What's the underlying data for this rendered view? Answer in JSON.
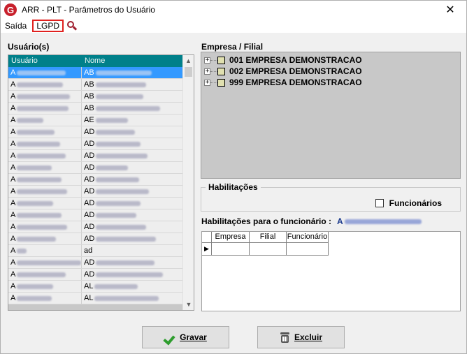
{
  "window": {
    "title": "ARR - PLT - Parâmetros do Usuário",
    "close_glyph": "✕",
    "app_icon_letter": "G",
    "app_icon_color": "#c8202c"
  },
  "menu": {
    "saida": "Saída",
    "lgpd": "LGPD",
    "search_icon": "search-icon"
  },
  "users": {
    "section_label": "Usuário(s)",
    "columns": [
      "Usuário",
      "Nome"
    ],
    "rows": [
      {
        "user": "A",
        "name": "AB"
      },
      {
        "user": "A",
        "name": "AB"
      },
      {
        "user": "A",
        "name": "AB"
      },
      {
        "user": "A",
        "name": "AB"
      },
      {
        "user": "A",
        "name": "AE"
      },
      {
        "user": "A",
        "name": "AD"
      },
      {
        "user": "A",
        "name": "AD"
      },
      {
        "user": "A",
        "name": "AD"
      },
      {
        "user": "A",
        "name": "AD"
      },
      {
        "user": "A",
        "name": "AD"
      },
      {
        "user": "A",
        "name": "AD"
      },
      {
        "user": "A",
        "name": "AD"
      },
      {
        "user": "A",
        "name": "AD"
      },
      {
        "user": "A",
        "name": "AD"
      },
      {
        "user": "A",
        "name": "AD"
      },
      {
        "user": "A",
        "name": "ad"
      },
      {
        "user": "A",
        "name": "AD"
      },
      {
        "user": "A",
        "name": "AD"
      },
      {
        "user": "A",
        "name": "AL"
      },
      {
        "user": "A",
        "name": "AL"
      }
    ],
    "selected_index": 0,
    "header_color": "#00808a",
    "selected_color": "#3399ff"
  },
  "companies": {
    "section_label": "Empresa / Filial",
    "items": [
      "001 EMPRESA DEMONSTRACAO",
      "002 EMPRESA DEMONSTRACAO",
      "999 EMPRESA DEMONSTRACAO"
    ],
    "expander": "+"
  },
  "habilitacoes": {
    "legend": "Habilitações",
    "funcionarios_label": "Funcionários",
    "funcionarios_checked": false
  },
  "habilitacoes_func": {
    "label": "Habilitações para o funcionário :",
    "value_prefix": "A",
    "columns": [
      "Empresa",
      "Filial",
      "Funcionário"
    ],
    "row_indicator": "▶"
  },
  "buttons": {
    "gravar": "Gravar",
    "excluir": "Excluir"
  }
}
